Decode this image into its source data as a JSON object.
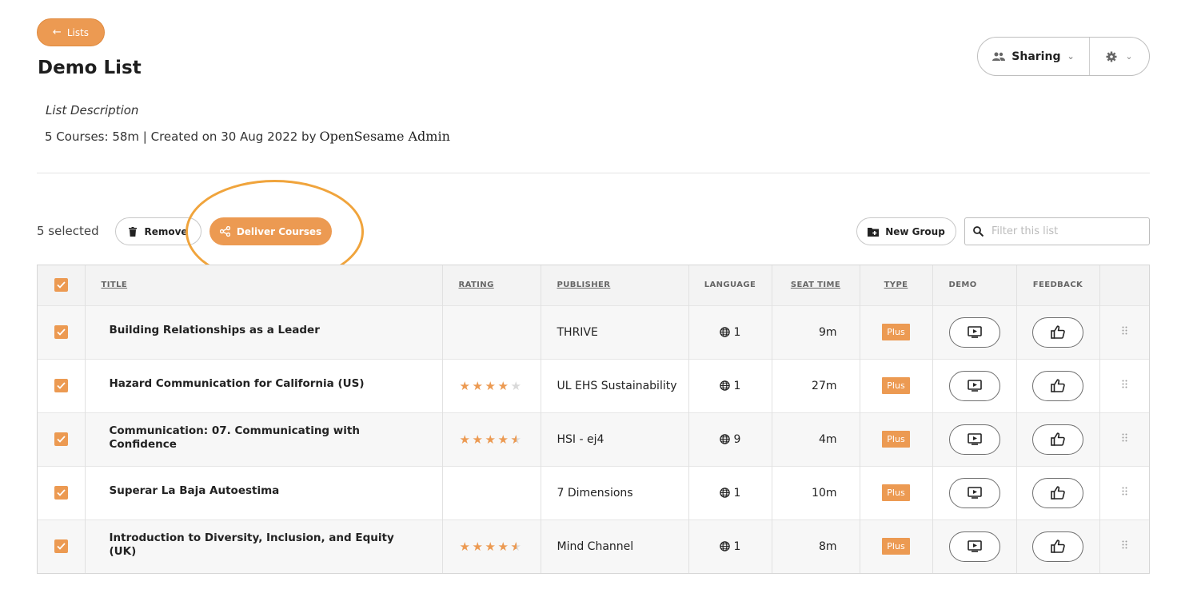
{
  "back_button": {
    "label": "Lists"
  },
  "page": {
    "title": "Demo List",
    "description": "List Description",
    "meta": "5 Courses: 58m | Created on 30 Aug 2022 by",
    "author": "OpenSesame Admin"
  },
  "toolbar": {
    "sharing_label": "Sharing",
    "selected_text": "5 selected",
    "remove_label": "Remove",
    "deliver_label": "Deliver Courses",
    "new_group_label": "New Group",
    "filter_placeholder": "Filter this list"
  },
  "table": {
    "headers": {
      "title": "TITLE",
      "rating": "RATING",
      "publisher": "PUBLISHER",
      "language": "LANGUAGE",
      "seat_time": "SEAT TIME",
      "type": "TYPE",
      "demo": "DEMO",
      "feedback": "FEEDBACK"
    },
    "rows": [
      {
        "title": "Building Relationships as a Leader",
        "rating": null,
        "publisher": "THRIVE",
        "languages": "1",
        "seat_time": "9m",
        "type": "Plus"
      },
      {
        "title": "Hazard Communication for California (US)",
        "rating": 4,
        "publisher": "UL EHS Sustainability",
        "languages": "1",
        "seat_time": "27m",
        "type": "Plus"
      },
      {
        "title": "Communication: 07. Communicating with Confidence",
        "rating": 4.5,
        "publisher": "HSI - ej4",
        "languages": "9",
        "seat_time": "4m",
        "type": "Plus"
      },
      {
        "title": "Superar La Baja Autoestima",
        "rating": null,
        "publisher": "7 Dimensions",
        "languages": "1",
        "seat_time": "10m",
        "type": "Plus"
      },
      {
        "title": "Introduction to Diversity, Inclusion, and Equity (UK)",
        "rating": 4.5,
        "publisher": "Mind Channel",
        "languages": "1",
        "seat_time": "8m",
        "type": "Plus"
      }
    ]
  },
  "icons": [
    "arrow-left-icon",
    "people-icon",
    "chevron-down-icon",
    "gear-icon",
    "trash-icon",
    "share-icon",
    "folder-plus-icon",
    "search-icon",
    "checkbox-icon",
    "star-icon",
    "globe-icon",
    "play-icon",
    "thumbs-up-icon",
    "drag-handle-icon"
  ],
  "colors": {
    "accent": "#ec9a52",
    "highlight_ring": "#f0a43c"
  }
}
